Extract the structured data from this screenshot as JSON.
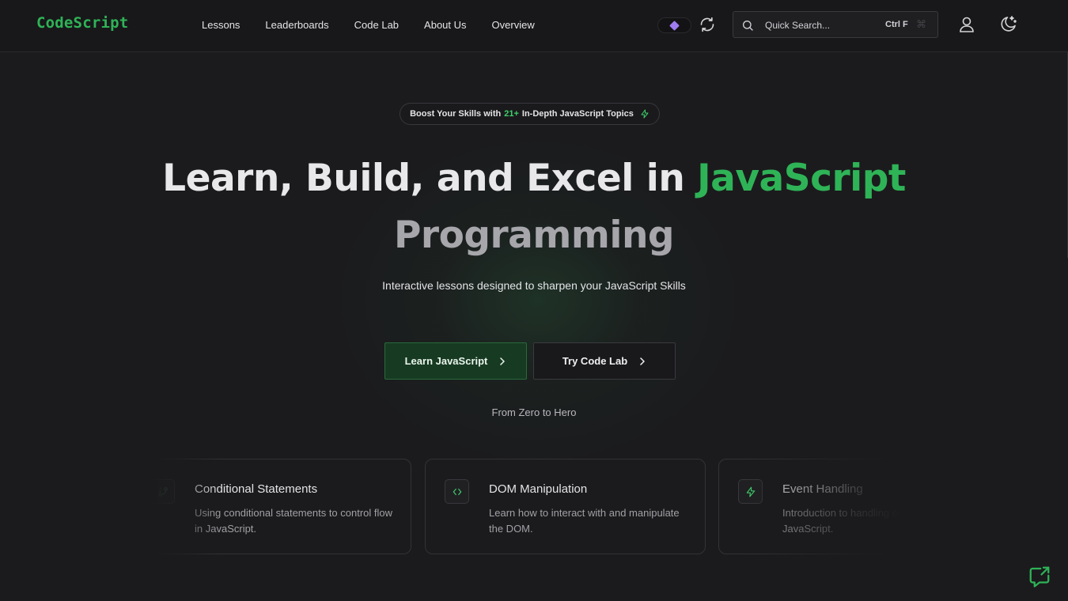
{
  "header": {
    "logo": "CodeScript",
    "nav": [
      "Lessons",
      "Leaderboards",
      "Code Lab",
      "About Us",
      "Overview"
    ],
    "search": {
      "placeholder": "Quick Search...",
      "shortcut": "Ctrl F",
      "shortcut_icon": "⌘"
    },
    "icons": [
      "premium-diamond-icon",
      "refresh-icon",
      "search-icon",
      "user-icon",
      "theme-toggle-icon"
    ]
  },
  "hero": {
    "badge": {
      "prefix": "Boost Your Skills with",
      "number": "21+",
      "suffix": "In-Depth JavaScript Topics"
    },
    "title_part1": "Learn, Build, and Excel in",
    "title_accent": "JavaScript",
    "title_line2": "Programming",
    "subtitle": "Interactive lessons designed to sharpen your JavaScript Skills",
    "primary_button": "Learn JavaScript",
    "secondary_button": "Try Code Lab",
    "tagline": "From Zero to Hero"
  },
  "cards": [
    {
      "title": "Conditional Statements",
      "description": "Using conditional statements to control flow in JavaScript.",
      "icon": "branch-icon"
    },
    {
      "title": "DOM Manipulation",
      "description": "Learn how to interact with and manipulate the DOM.",
      "icon": "code-brackets-icon"
    },
    {
      "title": "Event Handling",
      "description": "Introduction to handling events in JavaScript.",
      "icon": "lightning-icon"
    }
  ],
  "colors": {
    "accent": "#2fb357",
    "background": "#1b1b1d",
    "premium": "#a07cf0"
  }
}
